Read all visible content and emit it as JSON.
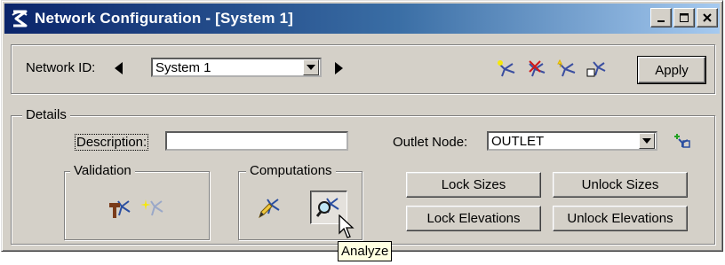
{
  "window": {
    "title": "Network Configuration - [System 1]",
    "title_buttons": [
      "minimize-icon",
      "maximize-icon",
      "close-icon"
    ]
  },
  "network": {
    "label": "Network ID:",
    "selected": "System 1",
    "toolbar_icons": [
      "add-network-icon",
      "delete-network-icon",
      "new-network-icon",
      "copy-network-icon"
    ],
    "apply_label": "Apply"
  },
  "details": {
    "legend": "Details",
    "description_label": "Description:",
    "description_value": "",
    "outlet_label": "Outlet Node:",
    "outlet_value": "OUTLET",
    "outlet_pick_icon": "locate-node-icon"
  },
  "validation": {
    "legend": "Validation",
    "icons": [
      "validate-repair-icon",
      "validate-highlight-icon"
    ]
  },
  "computations": {
    "legend": "Computations",
    "icons": [
      "design-pencil-icon",
      "analyze-icon"
    ]
  },
  "actions": {
    "lock_sizes": "Lock Sizes",
    "unlock_sizes": "Unlock Sizes",
    "lock_elevations": "Lock Elevations",
    "unlock_elevations": "Unlock Elevations"
  },
  "tooltip": "Analyze",
  "colors": {
    "title_gradient_start": "#0a246a",
    "title_gradient_end": "#a6caf0",
    "face": "#d4d0c8",
    "tooltip_bg": "#ffffe1"
  }
}
